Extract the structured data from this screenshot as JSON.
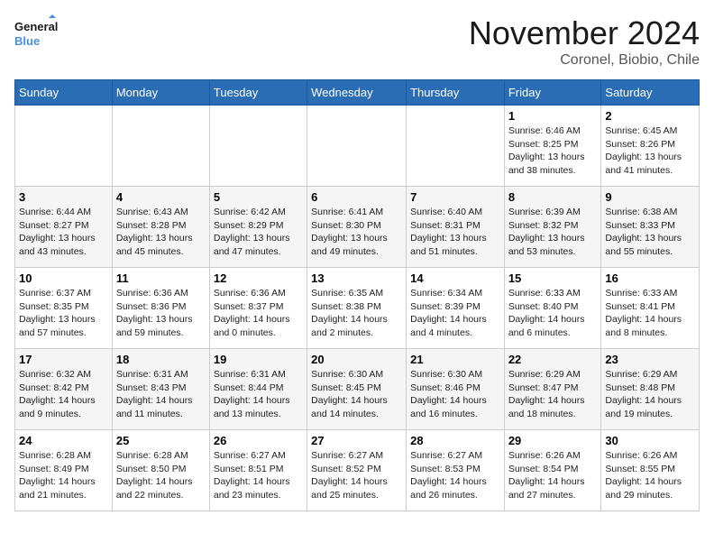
{
  "logo": {
    "line1": "General",
    "line2": "Blue"
  },
  "title": "November 2024",
  "subtitle": "Coronel, Biobio, Chile",
  "days_header": [
    "Sunday",
    "Monday",
    "Tuesday",
    "Wednesday",
    "Thursday",
    "Friday",
    "Saturday"
  ],
  "weeks": [
    [
      {
        "day": "",
        "info": ""
      },
      {
        "day": "",
        "info": ""
      },
      {
        "day": "",
        "info": ""
      },
      {
        "day": "",
        "info": ""
      },
      {
        "day": "",
        "info": ""
      },
      {
        "day": "1",
        "info": "Sunrise: 6:46 AM\nSunset: 8:25 PM\nDaylight: 13 hours\nand 38 minutes."
      },
      {
        "day": "2",
        "info": "Sunrise: 6:45 AM\nSunset: 8:26 PM\nDaylight: 13 hours\nand 41 minutes."
      }
    ],
    [
      {
        "day": "3",
        "info": "Sunrise: 6:44 AM\nSunset: 8:27 PM\nDaylight: 13 hours\nand 43 minutes."
      },
      {
        "day": "4",
        "info": "Sunrise: 6:43 AM\nSunset: 8:28 PM\nDaylight: 13 hours\nand 45 minutes."
      },
      {
        "day": "5",
        "info": "Sunrise: 6:42 AM\nSunset: 8:29 PM\nDaylight: 13 hours\nand 47 minutes."
      },
      {
        "day": "6",
        "info": "Sunrise: 6:41 AM\nSunset: 8:30 PM\nDaylight: 13 hours\nand 49 minutes."
      },
      {
        "day": "7",
        "info": "Sunrise: 6:40 AM\nSunset: 8:31 PM\nDaylight: 13 hours\nand 51 minutes."
      },
      {
        "day": "8",
        "info": "Sunrise: 6:39 AM\nSunset: 8:32 PM\nDaylight: 13 hours\nand 53 minutes."
      },
      {
        "day": "9",
        "info": "Sunrise: 6:38 AM\nSunset: 8:33 PM\nDaylight: 13 hours\nand 55 minutes."
      }
    ],
    [
      {
        "day": "10",
        "info": "Sunrise: 6:37 AM\nSunset: 8:35 PM\nDaylight: 13 hours\nand 57 minutes."
      },
      {
        "day": "11",
        "info": "Sunrise: 6:36 AM\nSunset: 8:36 PM\nDaylight: 13 hours\nand 59 minutes."
      },
      {
        "day": "12",
        "info": "Sunrise: 6:36 AM\nSunset: 8:37 PM\nDaylight: 14 hours\nand 0 minutes."
      },
      {
        "day": "13",
        "info": "Sunrise: 6:35 AM\nSunset: 8:38 PM\nDaylight: 14 hours\nand 2 minutes."
      },
      {
        "day": "14",
        "info": "Sunrise: 6:34 AM\nSunset: 8:39 PM\nDaylight: 14 hours\nand 4 minutes."
      },
      {
        "day": "15",
        "info": "Sunrise: 6:33 AM\nSunset: 8:40 PM\nDaylight: 14 hours\nand 6 minutes."
      },
      {
        "day": "16",
        "info": "Sunrise: 6:33 AM\nSunset: 8:41 PM\nDaylight: 14 hours\nand 8 minutes."
      }
    ],
    [
      {
        "day": "17",
        "info": "Sunrise: 6:32 AM\nSunset: 8:42 PM\nDaylight: 14 hours\nand 9 minutes."
      },
      {
        "day": "18",
        "info": "Sunrise: 6:31 AM\nSunset: 8:43 PM\nDaylight: 14 hours\nand 11 minutes."
      },
      {
        "day": "19",
        "info": "Sunrise: 6:31 AM\nSunset: 8:44 PM\nDaylight: 14 hours\nand 13 minutes."
      },
      {
        "day": "20",
        "info": "Sunrise: 6:30 AM\nSunset: 8:45 PM\nDaylight: 14 hours\nand 14 minutes."
      },
      {
        "day": "21",
        "info": "Sunrise: 6:30 AM\nSunset: 8:46 PM\nDaylight: 14 hours\nand 16 minutes."
      },
      {
        "day": "22",
        "info": "Sunrise: 6:29 AM\nSunset: 8:47 PM\nDaylight: 14 hours\nand 18 minutes."
      },
      {
        "day": "23",
        "info": "Sunrise: 6:29 AM\nSunset: 8:48 PM\nDaylight: 14 hours\nand 19 minutes."
      }
    ],
    [
      {
        "day": "24",
        "info": "Sunrise: 6:28 AM\nSunset: 8:49 PM\nDaylight: 14 hours\nand 21 minutes."
      },
      {
        "day": "25",
        "info": "Sunrise: 6:28 AM\nSunset: 8:50 PM\nDaylight: 14 hours\nand 22 minutes."
      },
      {
        "day": "26",
        "info": "Sunrise: 6:27 AM\nSunset: 8:51 PM\nDaylight: 14 hours\nand 23 minutes."
      },
      {
        "day": "27",
        "info": "Sunrise: 6:27 AM\nSunset: 8:52 PM\nDaylight: 14 hours\nand 25 minutes."
      },
      {
        "day": "28",
        "info": "Sunrise: 6:27 AM\nSunset: 8:53 PM\nDaylight: 14 hours\nand 26 minutes."
      },
      {
        "day": "29",
        "info": "Sunrise: 6:26 AM\nSunset: 8:54 PM\nDaylight: 14 hours\nand 27 minutes."
      },
      {
        "day": "30",
        "info": "Sunrise: 6:26 AM\nSunset: 8:55 PM\nDaylight: 14 hours\nand 29 minutes."
      }
    ]
  ]
}
